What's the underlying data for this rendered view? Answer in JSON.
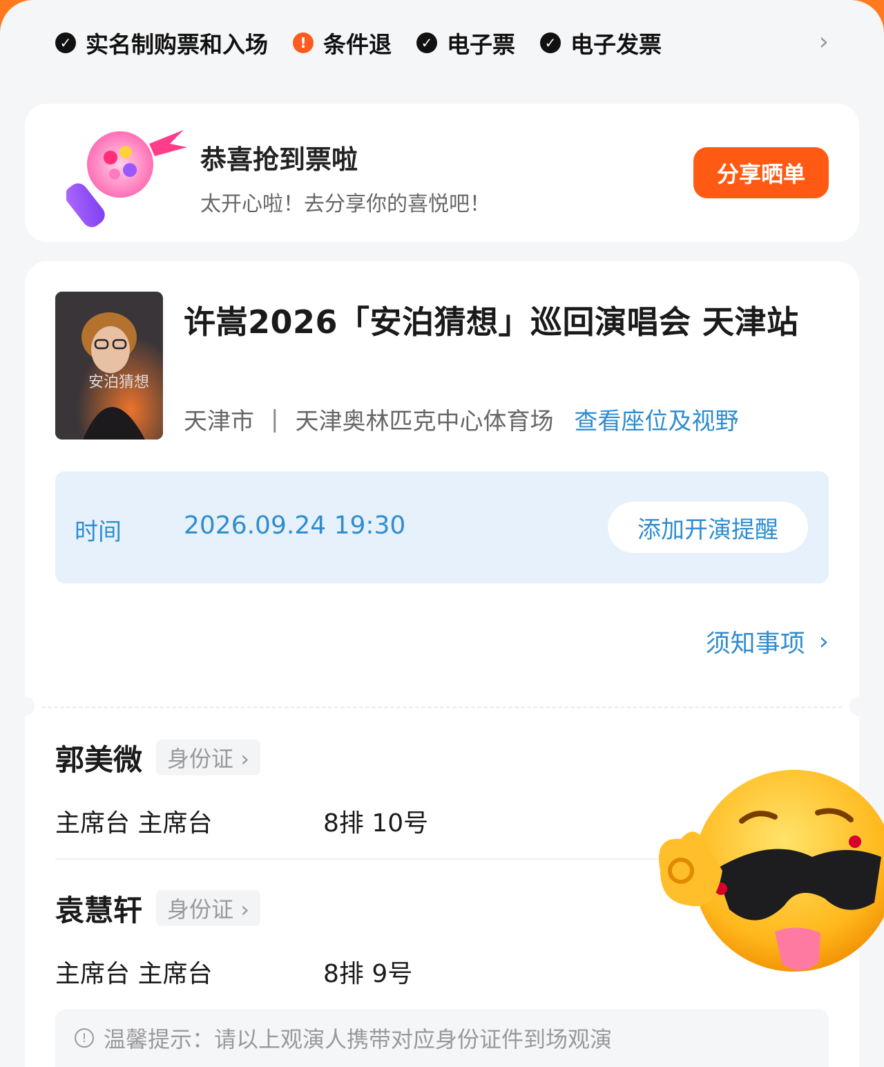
{
  "guarantees": [
    {
      "icon": "check-icon",
      "label": "实名制购票和入场",
      "status": "ok"
    },
    {
      "icon": "alert-icon",
      "label": "条件退",
      "status": "warn"
    },
    {
      "icon": "check-icon",
      "label": "电子票",
      "status": "ok"
    },
    {
      "icon": "check-icon",
      "label": "电子发票",
      "status": "ok"
    }
  ],
  "congrats": {
    "title": "恭喜抢到票啦",
    "subtitle": "太开心啦！去分享你的喜悦吧！",
    "share_button": "分享晒单"
  },
  "show": {
    "title": "许嵩2026「安泊猜想」巡回演唱会 天津站",
    "city": "天津市",
    "separator": "|",
    "venue": "天津奥林匹克中心体育场",
    "seat_view_link": "查看座位及视野",
    "poster_title": "安泊猜想"
  },
  "time": {
    "label": "时间",
    "value": "2026.09.24 19:30",
    "remind_button": "添加开演提醒"
  },
  "notice_link": "须知事项",
  "viewers": [
    {
      "name": "郭美微",
      "id_type": "身份证 ›",
      "area": "主席台 主席台",
      "seat": "8排 10号"
    },
    {
      "name": "袁慧轩",
      "id_type": "身份证 ›",
      "area": "主席台 主席台",
      "seat": "8排 9号"
    }
  ],
  "tip": "温馨提示：请以上观演人携带对应身份证件到场观演",
  "colors": {
    "accent": "#ff5a14",
    "link": "#2f8ccf",
    "time_bg": "#e6f1fb"
  }
}
